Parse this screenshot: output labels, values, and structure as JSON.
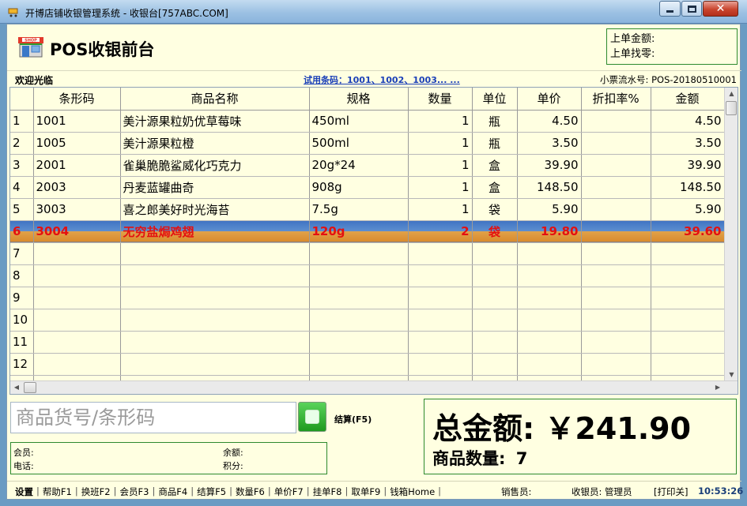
{
  "window": {
    "title": "开博店铺收银管理系统 - 收银台[757ABC.COM]"
  },
  "header": {
    "title": "POS收银前台",
    "last_amount_label": "上单金额:",
    "last_change_label": "上单找零:"
  },
  "infobar": {
    "welcome": "欢迎光临",
    "trial_barcodes": "试用条码：1001、1002、1003... ...",
    "receipt_no": "小票流水号: POS-20180510001"
  },
  "table": {
    "columns": [
      "条形码",
      "商品名称",
      "规格",
      "数量",
      "单位",
      "单价",
      "折扣率%",
      "金额"
    ],
    "rows": [
      {
        "no": "1",
        "barcode": "1001",
        "name": "美汁源果粒奶优草莓味",
        "spec": "450ml",
        "qty": "1",
        "unit": "瓶",
        "price": "4.50",
        "discount": "",
        "amount": "4.50"
      },
      {
        "no": "2",
        "barcode": "1005",
        "name": "美汁源果粒橙",
        "spec": "500ml",
        "qty": "1",
        "unit": "瓶",
        "price": "3.50",
        "discount": "",
        "amount": "3.50"
      },
      {
        "no": "3",
        "barcode": "2001",
        "name": "雀巢脆脆鲨威化巧克力",
        "spec": "20g*24",
        "qty": "1",
        "unit": "盒",
        "price": "39.90",
        "discount": "",
        "amount": "39.90"
      },
      {
        "no": "4",
        "barcode": "2003",
        "name": "丹麦蓝罐曲奇",
        "spec": "908g",
        "qty": "1",
        "unit": "盒",
        "price": "148.50",
        "discount": "",
        "amount": "148.50"
      },
      {
        "no": "5",
        "barcode": "3003",
        "name": "喜之郎美好时光海苔",
        "spec": "7.5g",
        "qty": "1",
        "unit": "袋",
        "price": "5.90",
        "discount": "",
        "amount": "5.90"
      },
      {
        "no": "6",
        "barcode": "3004",
        "name": "无穷盐焗鸡翅",
        "spec": "120g",
        "qty": "2",
        "unit": "袋",
        "price": "19.80",
        "discount": "",
        "amount": "39.60"
      },
      {
        "no": "7",
        "barcode": "",
        "name": "",
        "spec": "",
        "qty": "",
        "unit": "",
        "price": "",
        "discount": "",
        "amount": ""
      },
      {
        "no": "8",
        "barcode": "",
        "name": "",
        "spec": "",
        "qty": "",
        "unit": "",
        "price": "",
        "discount": "",
        "amount": ""
      },
      {
        "no": "9",
        "barcode": "",
        "name": "",
        "spec": "",
        "qty": "",
        "unit": "",
        "price": "",
        "discount": "",
        "amount": ""
      },
      {
        "no": "10",
        "barcode": "",
        "name": "",
        "spec": "",
        "qty": "",
        "unit": "",
        "price": "",
        "discount": "",
        "amount": ""
      },
      {
        "no": "11",
        "barcode": "",
        "name": "",
        "spec": "",
        "qty": "",
        "unit": "",
        "price": "",
        "discount": "",
        "amount": ""
      },
      {
        "no": "12",
        "barcode": "",
        "name": "",
        "spec": "",
        "qty": "",
        "unit": "",
        "price": "",
        "discount": "",
        "amount": ""
      },
      {
        "no": "",
        "barcode": "",
        "name": "",
        "spec": "",
        "qty": "",
        "unit": "",
        "price": "",
        "discount": "",
        "amount": ""
      }
    ],
    "selected_row": 6
  },
  "input": {
    "placeholder": "商品货号/条形码",
    "value": ""
  },
  "checkout": {
    "label": "结算(F5)"
  },
  "member": {
    "member_label": "会员:",
    "balance_label": "余额:",
    "phone_label": "电话:",
    "points_label": "积分:"
  },
  "total": {
    "amount_text": "总金额: ￥241.90",
    "qty_label": "商品数量:",
    "qty_value": "7"
  },
  "status": {
    "menu": [
      "设置",
      "帮助F1",
      "换班F2",
      "会员F3",
      "商品F4",
      "结算F5",
      "数量F6",
      "单价F7",
      "挂单F8",
      "取单F9",
      "钱箱Home"
    ],
    "seller": "销售员:",
    "cashier": "收银员: 管理员",
    "print": "[打印关]",
    "time": "10:53:26"
  },
  "colors": {
    "panel_bg": "#ffffe1",
    "frame_green": "#2e8a2e",
    "selected_text": "#e41010",
    "link_blue": "#1a3fb8"
  }
}
